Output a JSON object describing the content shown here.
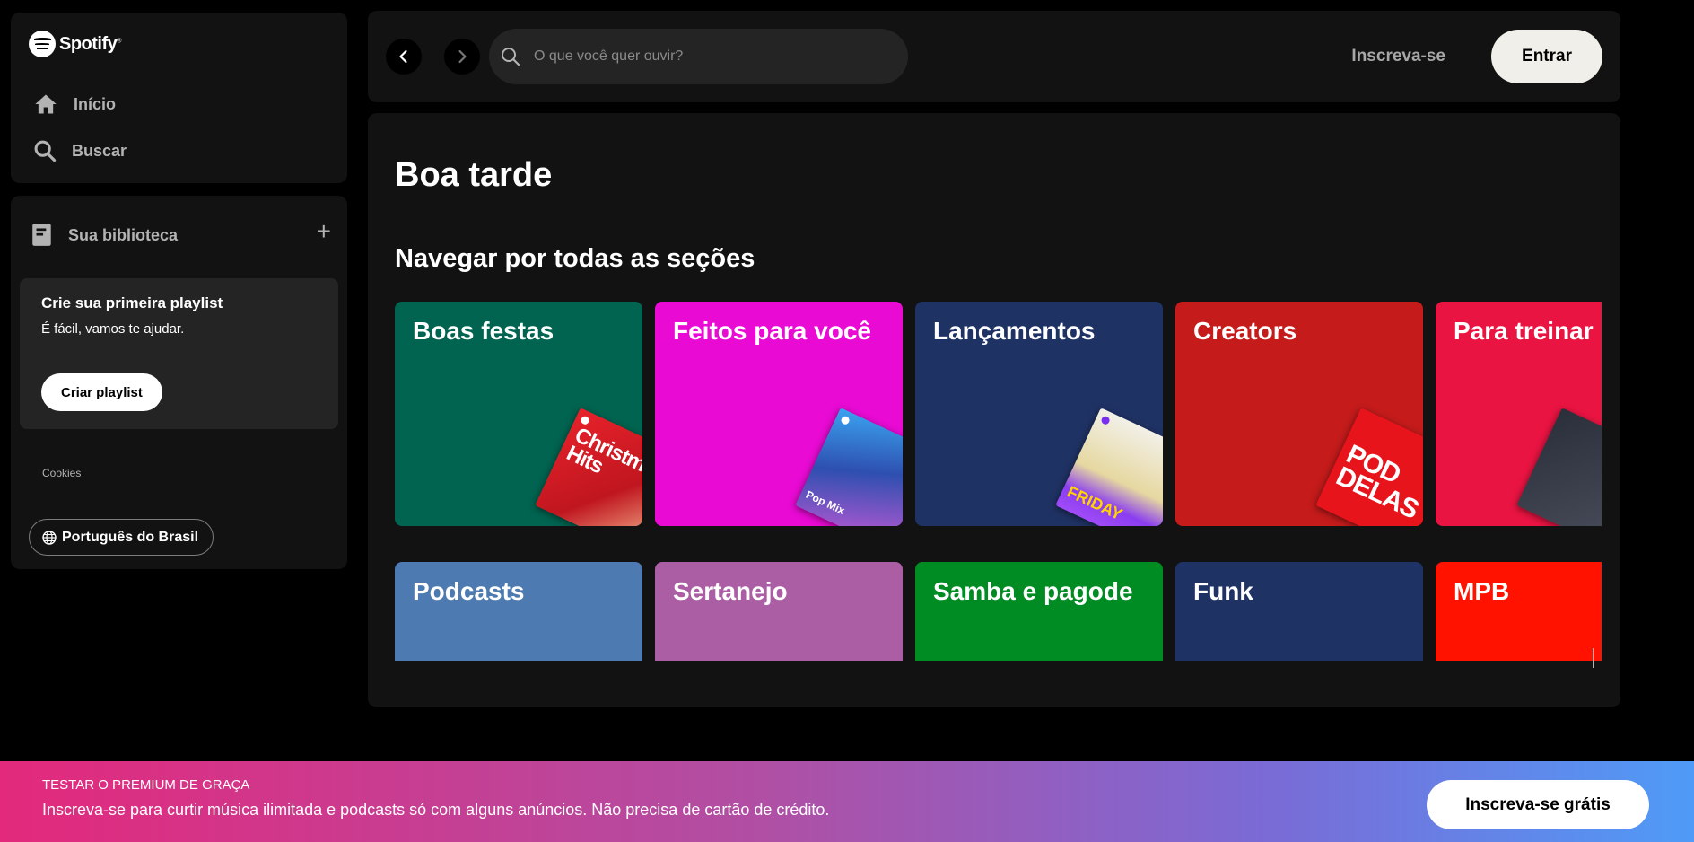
{
  "app": {
    "name": "Spotify"
  },
  "sidebar": {
    "nav": [
      {
        "label": "Início",
        "icon": "home-icon"
      },
      {
        "label": "Buscar",
        "icon": "search-icon"
      }
    ],
    "library": {
      "title": "Sua biblioteca",
      "add_icon": "plus-icon",
      "card": {
        "title": "Crie sua primeira playlist",
        "text": "É fácil, vamos te ajudar.",
        "button": "Criar playlist"
      },
      "cookies": "Cookies",
      "language_button": "Português do Brasil"
    }
  },
  "topbar": {
    "search_placeholder": "O que você quer ouvir?",
    "signup_label": "Inscreva-se",
    "login_label": "Entrar"
  },
  "main": {
    "greeting": "Boa tarde",
    "section_title": "Navegar por todas as seções",
    "categories": [
      {
        "title": "Boas festas",
        "color": "#006450",
        "art_text": "Christmas Hits"
      },
      {
        "title": "Feitos para você",
        "color": "#e90ad4",
        "art_text": "Pop Mix"
      },
      {
        "title": "Lançamentos",
        "color": "#1f3264",
        "art_text": "FRIDAY"
      },
      {
        "title": "Creators",
        "color": "#c51b1b",
        "art_text": "POD DELAS"
      },
      {
        "title": "Para treinar",
        "color": "#ea1442",
        "art_text": ""
      },
      {
        "title": "Podcasts",
        "color": "#4d7ab0"
      },
      {
        "title": "Sertanejo",
        "color": "#ab5ea3"
      },
      {
        "title": "Samba e pagode",
        "color": "#008b23"
      },
      {
        "title": "Funk",
        "color": "#1f3264"
      },
      {
        "title": "MPB",
        "color": "#ff1300"
      }
    ]
  },
  "banner": {
    "kicker": "TESTAR O PREMIUM DE GRAÇA",
    "text": "Inscreva-se para curtir música ilimitada e podcasts só com alguns anúncios. Não precisa de cartão de crédito.",
    "button": "Inscreva-se grátis"
  }
}
